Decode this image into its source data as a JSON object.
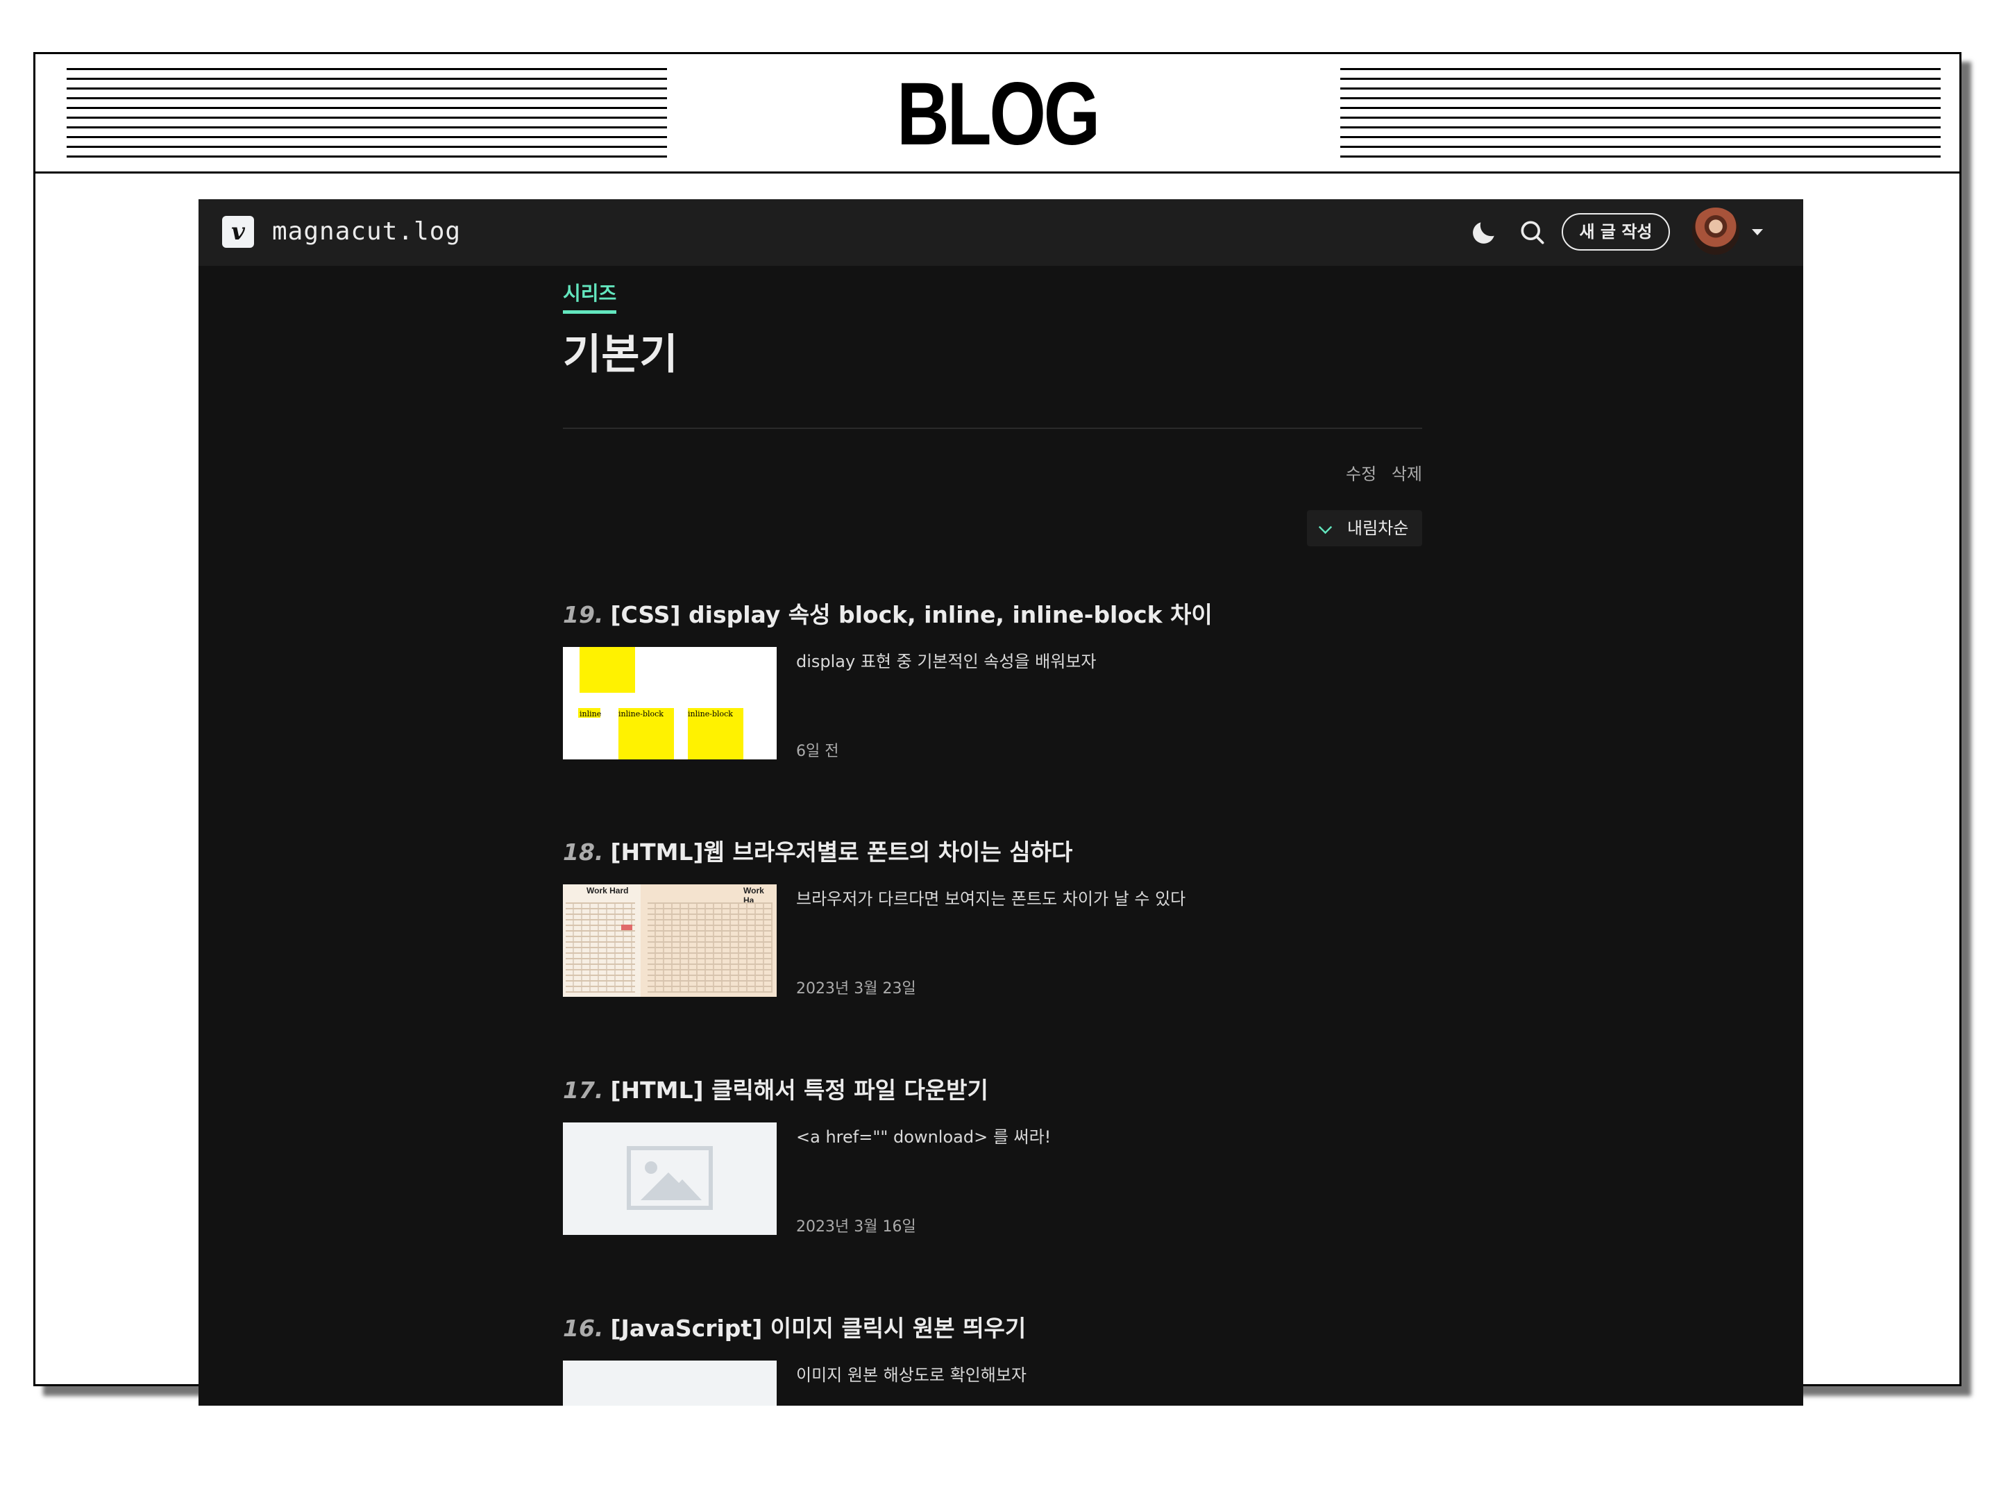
{
  "banner": {
    "title": "BLOG"
  },
  "header": {
    "logo_mark": "v",
    "logo_text": "magnacut.log",
    "theme_icon": "moon-icon",
    "search_icon": "search-icon",
    "write_label": "새 글 작성"
  },
  "series": {
    "label": "시리즈",
    "title": "기본기",
    "edit_label": "수정",
    "delete_label": "삭제",
    "sort_label": "내림차순"
  },
  "posts": [
    {
      "number": "19.",
      "title": "[CSS] display 속성 block, inline, inline-block 차이",
      "description": "display 표현 중 기본적인 속성을 배워보자",
      "date": "6일 전",
      "thumb_labels": [
        "inline",
        "inline-block",
        "inline-block"
      ]
    },
    {
      "number": "18.",
      "title": "[HTML]웹 브라우저별로 폰트의 차이는 심하다",
      "description": "브라우저가 다르다면 보여지는 폰트도 차이가 날 수 있다",
      "date": "2023년 3월 23일",
      "thumb_labels": [
        "Work Hard",
        "Work Ha"
      ]
    },
    {
      "number": "17.",
      "title": "[HTML] 클릭해서 특정 파일 다운받기",
      "description": "<a href=\"\" download> 를 써라!",
      "date": "2023년 3월 16일"
    },
    {
      "number": "16.",
      "title": "[JavaScript] 이미지 클릭시 원본 띄우기",
      "description": "이미지 원본 해상도로 확인해보자"
    }
  ],
  "colors": {
    "accent": "#63e6be",
    "background": "#121212",
    "header": "#1e1e1e",
    "highlight_yellow": "#fff200"
  }
}
